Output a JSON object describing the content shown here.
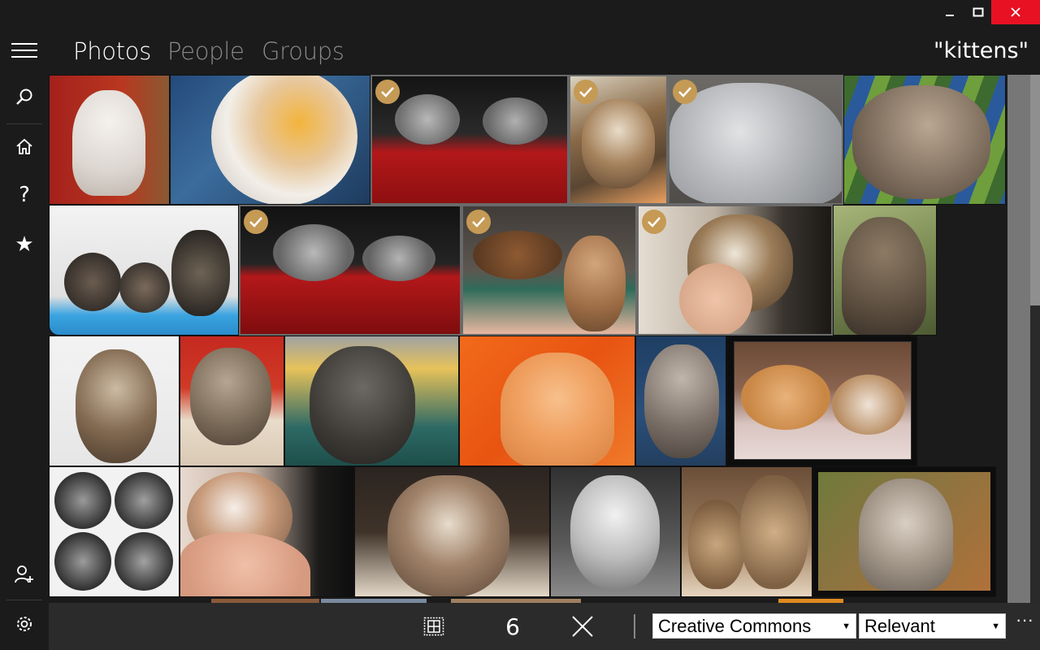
{
  "window": {
    "min_icon": "minimize-icon",
    "max_icon": "maximize-icon",
    "close_icon": "close-icon",
    "close_color": "#e81123"
  },
  "nav": {
    "items": [
      {
        "icon": "hamburger-menu-icon"
      },
      {
        "icon": "search-icon"
      },
      {
        "icon": "home-icon"
      },
      {
        "icon": "help-icon",
        "glyph": "?"
      },
      {
        "icon": "star-icon",
        "glyph": "★"
      },
      {
        "icon": "add-user-icon"
      },
      {
        "icon": "settings-gear-icon"
      }
    ]
  },
  "pivot": {
    "photos": "Photos",
    "people": "People",
    "groups": "Groups",
    "active": "Photos"
  },
  "search": {
    "query": "\"kittens\""
  },
  "grid": {
    "check_color": "#c59a55",
    "selected_count": 6,
    "rows": [
      [
        {
          "name": "white-kitten-on-red",
          "selected": false
        },
        {
          "name": "calico-kitten-closeup",
          "selected": false
        },
        {
          "name": "two-kittens-red-basket",
          "selected": true
        },
        {
          "name": "tabby-kitten-blanket",
          "selected": true
        },
        {
          "name": "fluffy-grey-cat",
          "selected": true
        },
        {
          "name": "tabby-kitten-striped-towel",
          "selected": false
        }
      ],
      [
        {
          "name": "three-kittens-blue",
          "selected": false
        },
        {
          "name": "two-kittens-red-basket-wide",
          "selected": true
        },
        {
          "name": "abyssinian-cats-bed",
          "selected": true
        },
        {
          "name": "tabby-kitten-in-hand",
          "selected": true
        },
        {
          "name": "tabby-kitten-outdoors",
          "selected": false
        }
      ],
      [
        {
          "name": "tabby-kitten-tongue",
          "selected": false
        },
        {
          "name": "tabby-kitten-red-wall",
          "selected": false
        },
        {
          "name": "grey-kitten-green-blanket",
          "selected": false
        },
        {
          "name": "orange-kitten-winking",
          "selected": false
        },
        {
          "name": "tabby-kitten-blue-blanket",
          "selected": false
        },
        {
          "name": "two-sleeping-kittens",
          "selected": false
        }
      ],
      [
        {
          "name": "kitten-collage-bw",
          "selected": false
        },
        {
          "name": "newborn-kitten-hand",
          "selected": false
        },
        {
          "name": "tabby-kitten-portrait",
          "selected": false
        },
        {
          "name": "white-kitten-bw",
          "selected": false
        },
        {
          "name": "two-bengal-kittens",
          "selected": false
        },
        {
          "name": "grey-tabby-kitten-green",
          "selected": false
        }
      ]
    ]
  },
  "commandbar": {
    "select_all_icon": "select-all-icon",
    "count": "6",
    "clear_icon": "clear-selection-icon",
    "license": {
      "value": "Creative Commons",
      "arrow": "▼"
    },
    "sort": {
      "value": "Relevant",
      "arrow": "▼"
    },
    "more": "···"
  }
}
